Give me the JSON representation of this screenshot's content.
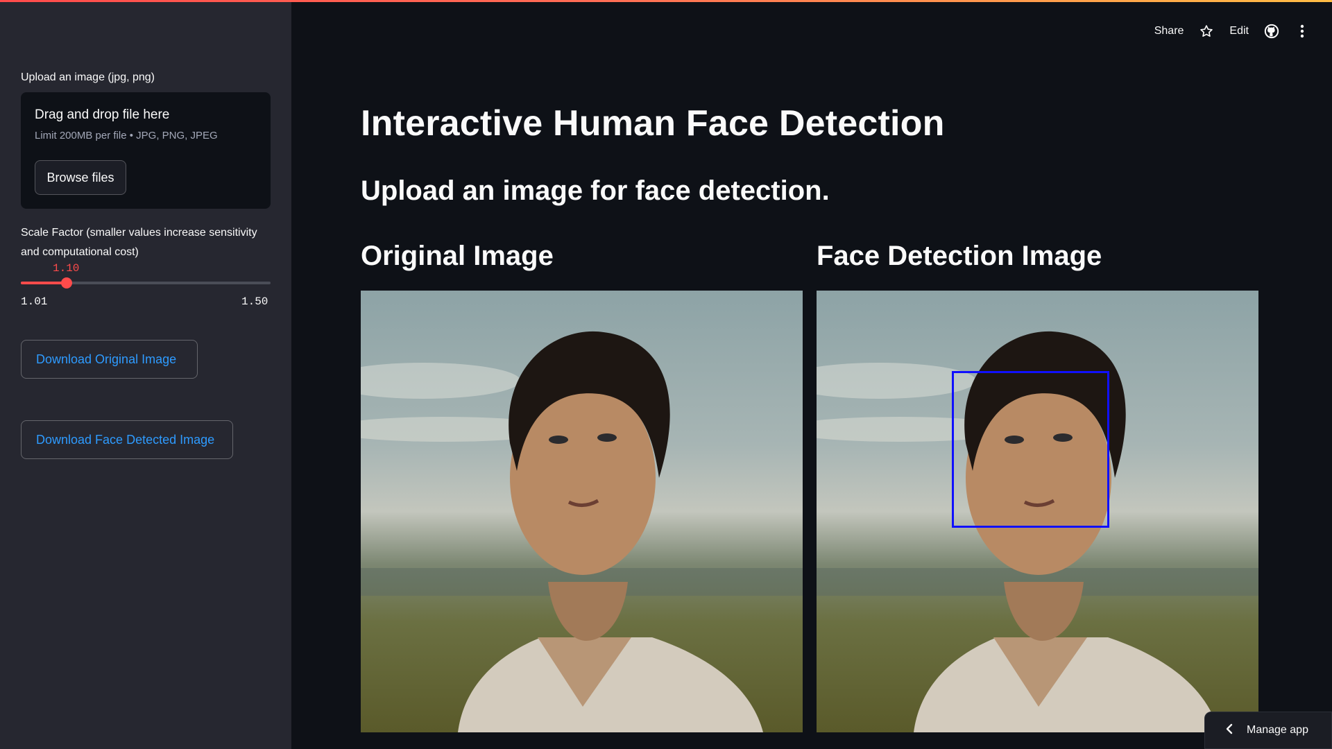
{
  "sidebar": {
    "uploader_label": "Upload an image (jpg, png)",
    "dropzone_title": "Drag and drop file here",
    "dropzone_limit": "Limit 200MB per file • JPG, PNG, JPEG",
    "browse_label": "Browse files",
    "slider": {
      "label": "Scale Factor (smaller values increase sensitivity and computational cost)",
      "value": "1.10",
      "min": "1.01",
      "max": "1.50",
      "fraction": 0.184
    },
    "download_original_label": "Download Original Image",
    "download_face_label": "Download Face Detected Image"
  },
  "header": {
    "share_label": "Share",
    "edit_label": "Edit",
    "icons": [
      "star-icon",
      "github-icon",
      "more-vertical-icon"
    ]
  },
  "main": {
    "title": "Interactive Human Face Detection",
    "subtitle": "Upload an image for face detection.",
    "left_column_title": "Original Image",
    "right_column_title": "Face Detection Image"
  },
  "footer": {
    "manage_app_label": "Manage app"
  },
  "colors": {
    "accent": "#ff4b4b",
    "link": "#2e9bff",
    "face_box": "#1010ff",
    "sidebar_bg": "#262730",
    "main_bg": "#0e1117"
  }
}
